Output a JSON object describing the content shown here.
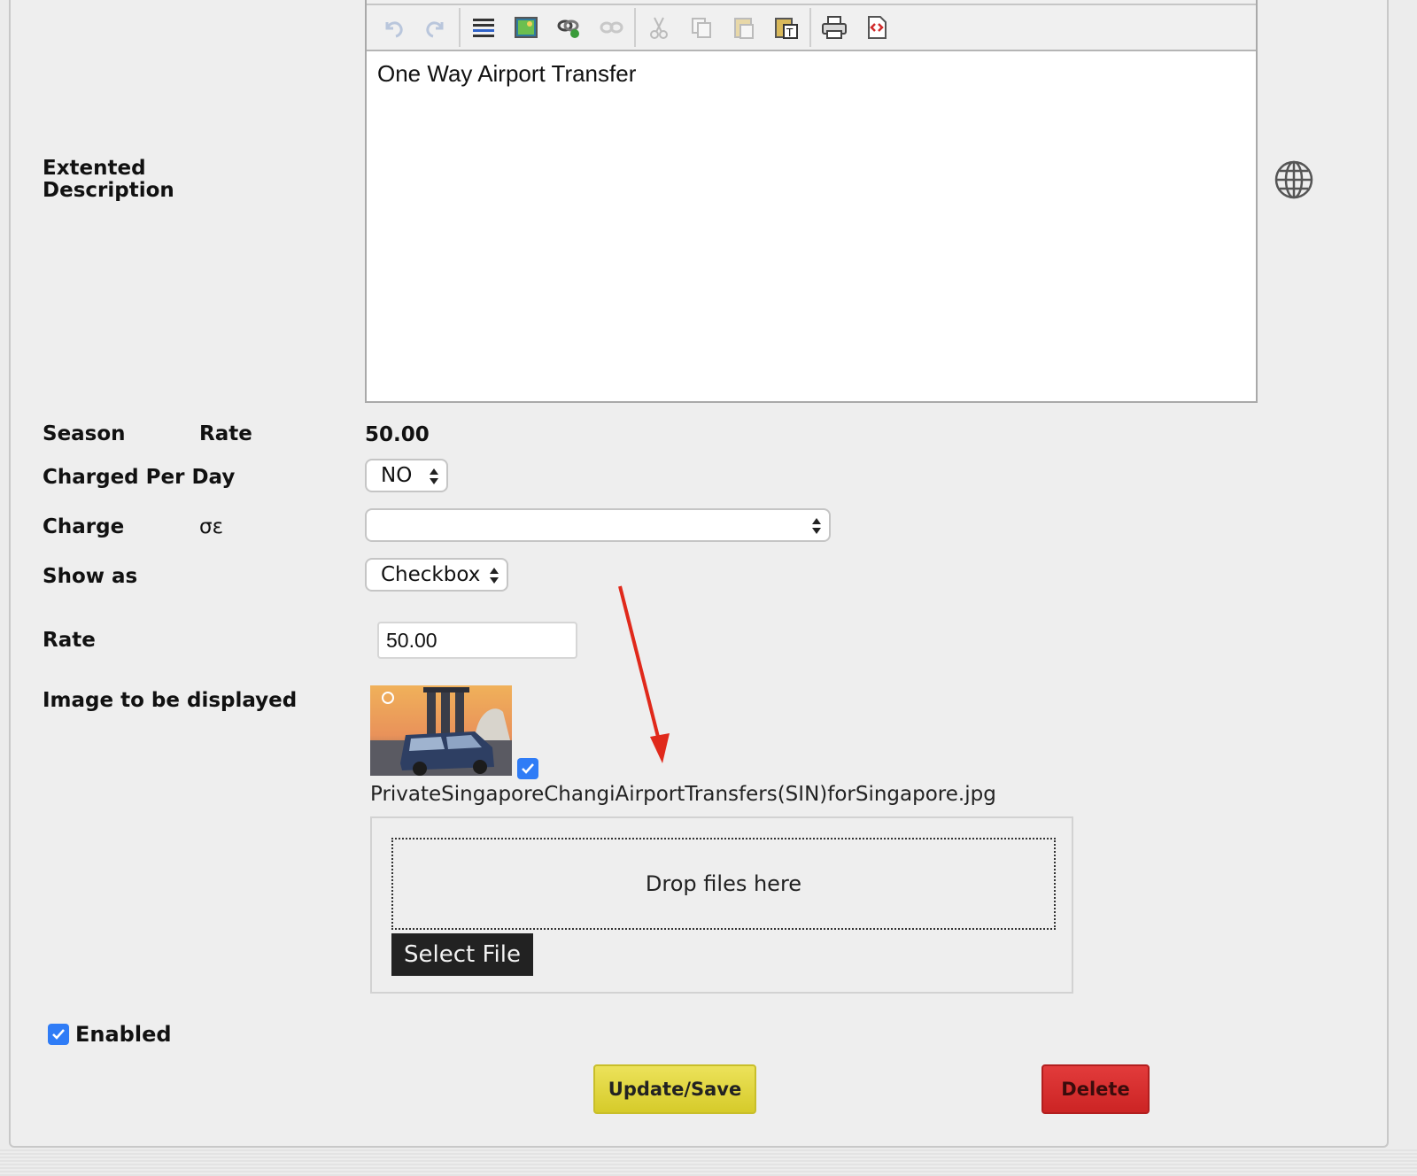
{
  "form": {
    "extended_description_label_line1": "Extented",
    "extended_description_label_line2": "Description",
    "editor_content": "One Way Airport Transfer",
    "season_label": "Season",
    "season_rate_label": "Rate",
    "season_rate_value": "50.00",
    "charged_per_day_label": "Charged Per Day",
    "charged_per_day_value": "NO",
    "charge_label": "Charge",
    "charge_sub": "σε",
    "charge_value": "",
    "show_as_label": "Show as",
    "show_as_value": "Checkbox",
    "rate_label": "Rate",
    "rate_value": "50.00",
    "image_label": "Image to be displayed",
    "image_filename": "PrivateSingaporeChangiAirportTransfers(SIN)forSingapore.jpg",
    "image_checked": true,
    "dropzone_text": "Drop files here",
    "select_file_label": "Select File",
    "enabled_label": "Enabled",
    "enabled_checked": true,
    "save_label": "Update/Save",
    "delete_label": "Delete"
  },
  "toolbar_icons": [
    "undo-icon",
    "redo-icon",
    "align-icon",
    "image-icon",
    "link-icon",
    "unlink-icon",
    "cut-icon",
    "copy-icon",
    "paste-icon",
    "paste-text-icon",
    "print-icon",
    "source-icon"
  ],
  "colors": {
    "accent_checkbox": "#2f7cf6",
    "save_button": "#e0d640",
    "delete_button": "#d62f2f",
    "annotation_arrow": "#e0291b"
  }
}
